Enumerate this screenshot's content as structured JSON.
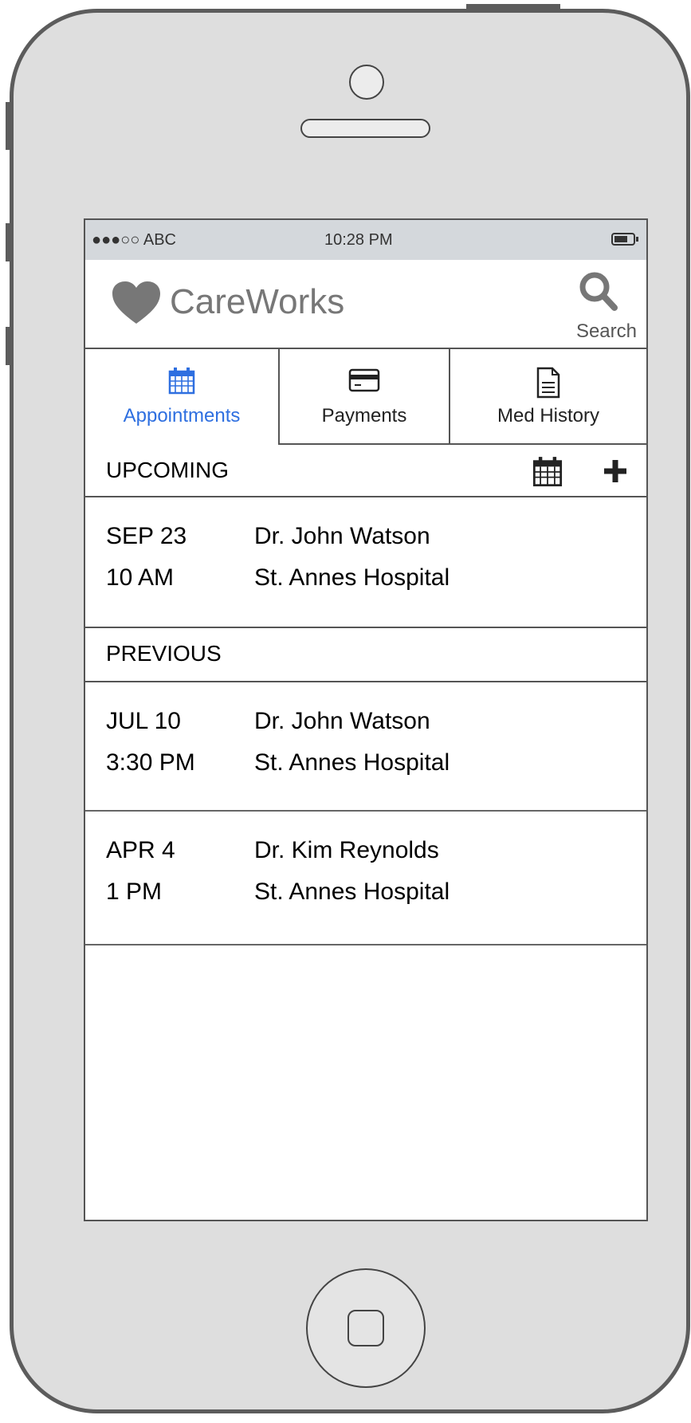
{
  "status_bar": {
    "carrier": "●●●○○ ABC",
    "time": "10:28 PM"
  },
  "header": {
    "brand": "CareWorks",
    "search_label": "Search",
    "brand_icon": "heart-icon",
    "search_icon": "search-icon"
  },
  "tabs": [
    {
      "label": "Appointments",
      "icon": "calendar-icon",
      "active": true
    },
    {
      "label": "Payments",
      "icon": "credit-card-icon",
      "active": false
    },
    {
      "label": "Med History",
      "icon": "document-icon",
      "active": false
    }
  ],
  "upcoming": {
    "title": "UPCOMING",
    "appointments": [
      {
        "date": "SEP 23",
        "time": "10 AM",
        "doctor": "Dr. John Watson",
        "location": "St. Annes Hospital"
      }
    ]
  },
  "previous": {
    "title": "PREVIOUS",
    "appointments": [
      {
        "date": "JUL 10",
        "time": "3:30 PM",
        "doctor": "Dr. John Watson",
        "location": "St. Annes Hospital"
      },
      {
        "date": "APR 4",
        "time": "1 PM",
        "doctor": "Dr. Kim Reynolds",
        "location": "St. Annes Hospital"
      }
    ]
  },
  "colors": {
    "accent": "#2e6fe0",
    "brand_gray": "#777777",
    "status_bar_bg": "#d4d8dc",
    "phone_body": "#dedede"
  }
}
